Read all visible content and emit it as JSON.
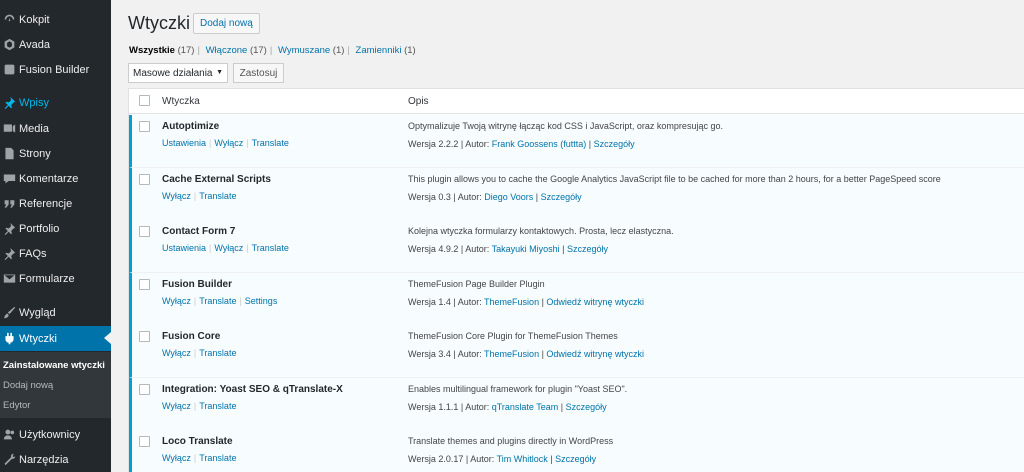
{
  "sidebar": {
    "items": [
      {
        "label": "Kokpit",
        "icon": "dashboard-icon"
      },
      {
        "label": "Avada",
        "icon": "avada-icon"
      },
      {
        "label": "Fusion Builder",
        "icon": "fusion-builder-icon"
      },
      {
        "label": "Wpisy",
        "icon": "pin-icon"
      },
      {
        "label": "Media",
        "icon": "media-icon"
      },
      {
        "label": "Strony",
        "icon": "pages-icon"
      },
      {
        "label": "Komentarze",
        "icon": "comment-icon"
      },
      {
        "label": "Referencje",
        "icon": "testimonial-icon"
      },
      {
        "label": "Portfolio",
        "icon": "pin-icon"
      },
      {
        "label": "FAQs",
        "icon": "pin-icon"
      },
      {
        "label": "Formularze",
        "icon": "mail-icon"
      },
      {
        "label": "Wygląd",
        "icon": "brush-icon"
      },
      {
        "label": "Wtyczki",
        "icon": "plugin-icon"
      },
      {
        "label": "Użytkownicy",
        "icon": "users-icon"
      },
      {
        "label": "Narzędzia",
        "icon": "tools-icon"
      }
    ],
    "submenu": [
      {
        "label": "Zainstalowane wtyczki"
      },
      {
        "label": "Dodaj nową"
      },
      {
        "label": "Edytor"
      }
    ],
    "colors": {
      "background": "#23282d",
      "active": "#0073aa",
      "highlight": "#00b9eb"
    }
  },
  "header": {
    "title": "Wtyczki",
    "add_new": "Dodaj nową"
  },
  "filters": [
    {
      "label": "Wszystkie",
      "count": "(17)"
    },
    {
      "label": "Włączone",
      "count": "(17)"
    },
    {
      "label": "Wymuszane",
      "count": "(1)"
    },
    {
      "label": "Zamienniki",
      "count": "(1)"
    }
  ],
  "bulk": {
    "select_value": "Masowe działania",
    "apply": "Zastosuj"
  },
  "table": {
    "col_name": "Wtyczka",
    "col_desc": "Opis",
    "rows": [
      {
        "name": "Autoptimize",
        "actions": [
          "Ustawienia",
          "Wyłącz",
          "Translate"
        ],
        "description": "Optymalizuje Twoją witrynę łącząc kod CSS i JavaScript, oraz kompresując go.",
        "version": "Wersja 2.2.2 | Autor: ",
        "author": "Frank Goossens (futtta)",
        "sep": " | ",
        "link": "Szczegóły"
      },
      {
        "name": "Cache External Scripts",
        "actions": [
          "Wyłącz",
          "Translate"
        ],
        "description": "This plugin allows you to cache the Google Analytics JavaScript file to be cached for more than 2 hours, for a better PageSpeed score",
        "version": "Wersja 0.3 | Autor: ",
        "author": "Diego Voors",
        "sep": " | ",
        "link": "Szczegóły"
      },
      {
        "name": "Contact Form 7",
        "actions": [
          "Ustawienia",
          "Wyłącz",
          "Translate"
        ],
        "description": "Kolejna wtyczka formularzy kontaktowych. Prosta, lecz elastyczna.",
        "version": "Wersja 4.9.2 | Autor: ",
        "author": "Takayuki Miyoshi",
        "sep": " | ",
        "link": "Szczegóły"
      },
      {
        "name": "Fusion Builder",
        "actions": [
          "Wyłącz",
          "Translate",
          "Settings"
        ],
        "description": "ThemeFusion Page Builder Plugin",
        "version": "Wersja 1.4 | Autor: ",
        "author": "ThemeFusion",
        "sep": " | ",
        "link": "Odwiedź witrynę wtyczki"
      },
      {
        "name": "Fusion Core",
        "actions": [
          "Wyłącz",
          "Translate"
        ],
        "description": "ThemeFusion Core Plugin for ThemeFusion Themes",
        "version": "Wersja 3.4 | Autor: ",
        "author": "ThemeFusion",
        "sep": " | ",
        "link": "Odwiedź witrynę wtyczki"
      },
      {
        "name": "Integration: Yoast SEO & qTranslate-X",
        "actions": [
          "Wyłącz",
          "Translate"
        ],
        "description": "Enables multilingual framework for plugin \"Yoast SEO\".",
        "version": "Wersja 1.1.1 | Autor: ",
        "author": "qTranslate Team",
        "sep": " | ",
        "link": "Szczegóły"
      },
      {
        "name": "Loco Translate",
        "actions": [
          "Wyłącz",
          "Translate"
        ],
        "description": "Translate themes and plugins directly in WordPress",
        "version": "Wersja 2.0.17 | Autor: ",
        "author": "Tim Whitlock",
        "sep": " | ",
        "link": "Szczegóły"
      }
    ]
  }
}
